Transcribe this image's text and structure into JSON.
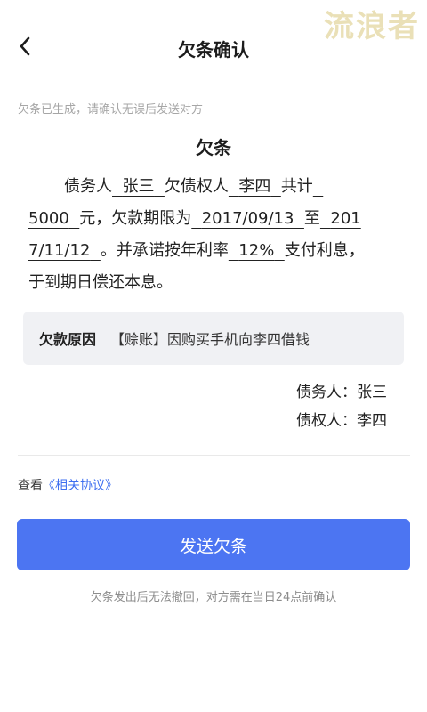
{
  "watermark": "流浪者",
  "nav": {
    "title": "欠条确认",
    "back_icon": "chevron-left-icon"
  },
  "hint": "欠条已生成，请确认无误后发送对方",
  "doc": {
    "title": "欠条",
    "debtor_label": "债务人",
    "debtor_name": "张三",
    "owe_label": "欠债权人",
    "creditor_name": "李四",
    "total_label": "共计",
    "amount": "5000",
    "amount_suffix": "元，欠款期限为",
    "start_date": "2017/09/13",
    "to_label": "至",
    "end_date_part1": "201",
    "end_date_part2": "7/11/12",
    "rate_prefix": "。并承诺按年利率",
    "rate": "12%",
    "rate_suffix": "支付利息，",
    "closing": "于到期日偿还本息。"
  },
  "reason": {
    "label": "欠款原因",
    "text": "【赊账】因购买手机向李四借钱"
  },
  "signatures": {
    "debtor": "债务人：张三",
    "creditor": "债权人：李四"
  },
  "agreement": {
    "prefix": "查看",
    "link": "《相关协议》"
  },
  "send_button": "发送欠条",
  "footer_note": "欠条发出后无法撤回，对方需在当日24点前确认",
  "colors": {
    "primary": "#4c75f2",
    "link": "#3e6ff0",
    "panel": "#f0f1f4"
  }
}
